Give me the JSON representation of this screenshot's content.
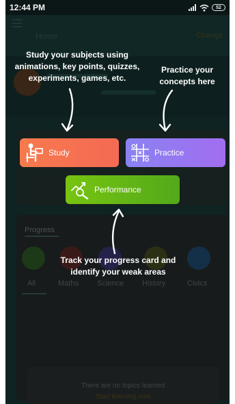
{
  "status_bar": {
    "time": "12:44 PM",
    "battery": "52"
  },
  "app": {
    "title": "Home",
    "change_label": "Change",
    "progress_title": "Progress",
    "subjects": [
      "All",
      "Maths",
      "Science",
      "History",
      "Civics"
    ],
    "empty_line1": "There are no topics learned",
    "empty_line2": "Start learning now"
  },
  "coachmarks": {
    "study_hint": "Study your subjects using animations, key points, quizzes, experiments, games, etc.",
    "practice_hint": "Practice your concepts here",
    "progress_hint": "Track your progress card and identify your weak areas"
  },
  "buttons": {
    "study": "Study",
    "practice": "Practice",
    "performance": "Performance"
  },
  "colors": {
    "study": "#f5714f",
    "practice": "#9a78f0",
    "performance": "#67b816",
    "overlay_bg": "#0f2322"
  }
}
